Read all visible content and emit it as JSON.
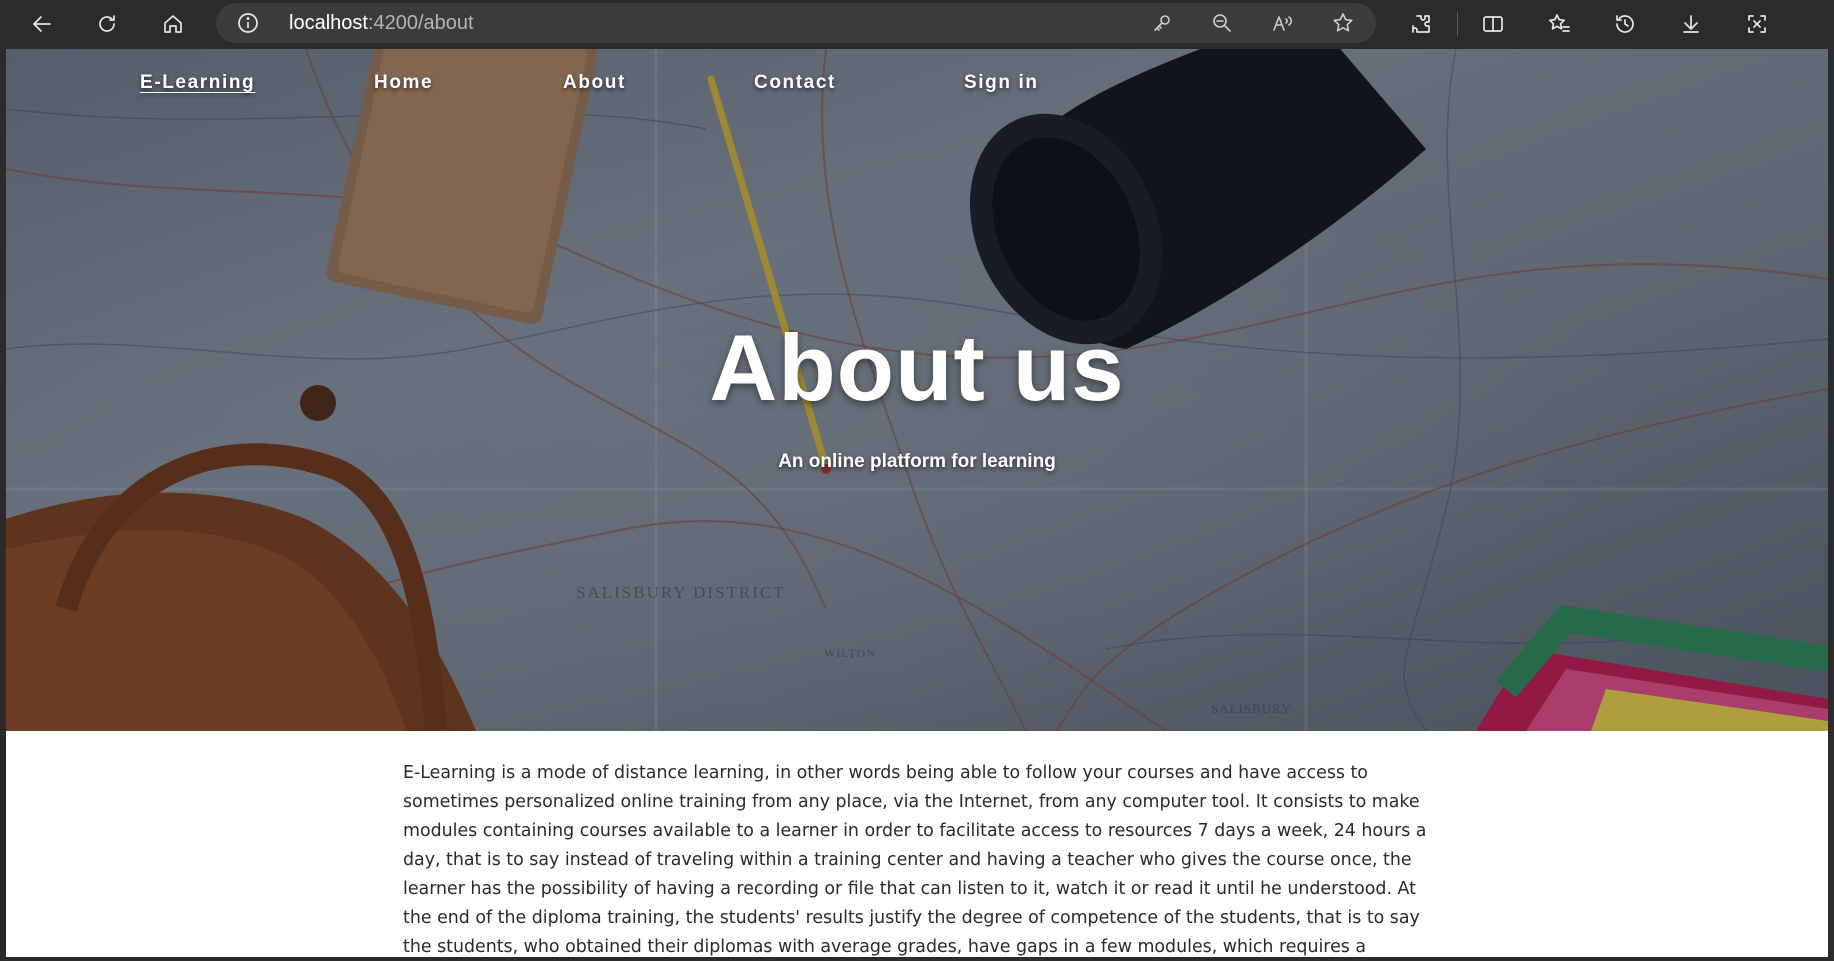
{
  "browser": {
    "url_host": "localhost",
    "url_path": ":4200/about",
    "icons": [
      "back-icon",
      "refresh-icon",
      "home-icon",
      "info-icon",
      "key-icon",
      "zoom-out-icon",
      "read-aloud-icon",
      "favorite-star-icon",
      "extensions-icon",
      "split-screen-icon",
      "favorites-icon",
      "history-icon",
      "download-icon",
      "screenshot-icon"
    ]
  },
  "nav": {
    "brand": "E-Learning",
    "home": "Home",
    "about": "About",
    "contact": "Contact",
    "signin": "Sign in"
  },
  "hero": {
    "title": "About us",
    "subtitle": "An online platform for learning",
    "map_labels": {
      "district": "SALISBURY DISTRICT",
      "town": "SALISBURY",
      "wilton": "WILTON"
    }
  },
  "about": {
    "paragraph": "E-Learning is a mode of distance learning, in other words being able to follow your courses and have access to sometimes personalized online training from any place, via the Internet, from any computer tool. It consists to make modules containing courses available to a learner in order to facilitate access to resources 7 days a week, 24 hours a day, that is to say instead of traveling within a training center and having a teacher who gives the course once, the learner has the possibility of having a recording or file that can listen to it, watch it or read it until he understood. At the end of the diploma training, the students' results justify the degree of competence of the students, that is to say the students, who obtained their diplomas with average grades, have gaps in a few modules, which requires a solution of improvement. The"
  }
}
